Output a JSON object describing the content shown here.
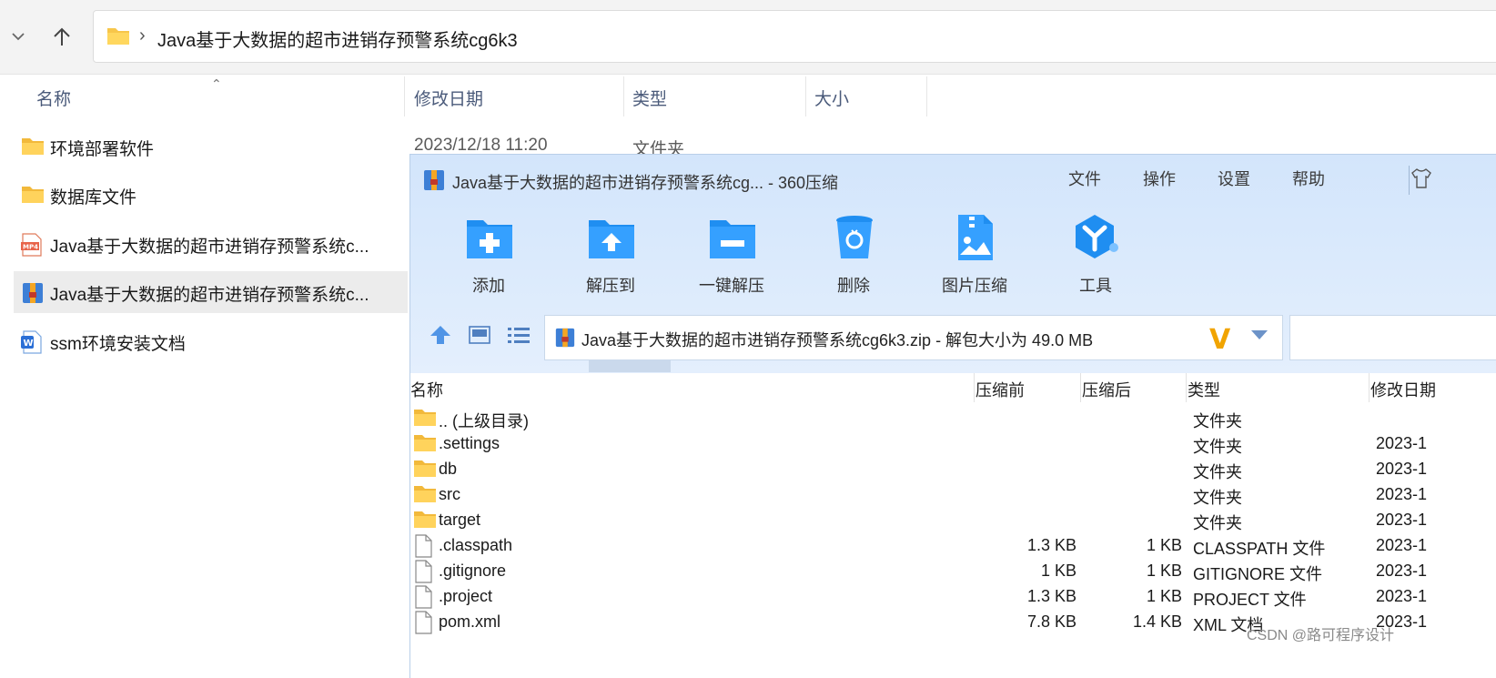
{
  "explorer": {
    "address_path": "Java基于大数据的超市进销存预警系统cg6k3",
    "columns": {
      "name": "名称",
      "modified": "修改日期",
      "type": "类型",
      "size": "大小"
    },
    "rows": [
      {
        "name": "环境部署软件",
        "icon": "folder-icon",
        "modified": "2023/12/18 11:20",
        "type": "文件夹"
      },
      {
        "name": "数据库文件",
        "icon": "folder-icon"
      },
      {
        "name": "Java基于大数据的超市进销存预警系统c...",
        "icon": "mp4-file-icon"
      },
      {
        "name": "Java基于大数据的超市进销存预警系统c...",
        "icon": "zip-archive-icon",
        "selected": true
      },
      {
        "name": "ssm环境安装文档",
        "icon": "word-doc-icon"
      }
    ]
  },
  "zip_window": {
    "title": "Java基于大数据的超市进销存预警系统cg... - 360压缩",
    "menu": [
      "文件",
      "操作",
      "设置",
      "帮助"
    ],
    "toolbar": [
      {
        "label": "添加",
        "icon": "add-icon"
      },
      {
        "label": "解压到",
        "icon": "extract-to-icon"
      },
      {
        "label": "一键解压",
        "icon": "one-click-extract-icon"
      },
      {
        "label": "删除",
        "icon": "delete-icon"
      },
      {
        "label": "图片压缩",
        "icon": "image-compress-icon"
      },
      {
        "label": "工具",
        "icon": "tools-icon"
      }
    ],
    "path_text": "Java基于大数据的超市进销存预警系统cg6k3.zip - 解包大小为 49.0 MB",
    "columns": {
      "name": "名称",
      "before": "压缩前",
      "after": "压缩后",
      "type": "类型",
      "modified": "修改日期"
    },
    "rows": [
      {
        "name": ".. (上级目录)",
        "icon": "folder-icon",
        "before": "",
        "after": "",
        "type": "文件夹",
        "date": ""
      },
      {
        "name": ".settings",
        "icon": "folder-icon",
        "before": "",
        "after": "",
        "type": "文件夹",
        "date": "2023-1"
      },
      {
        "name": "db",
        "icon": "folder-icon",
        "before": "",
        "after": "",
        "type": "文件夹",
        "date": "2023-1"
      },
      {
        "name": "src",
        "icon": "folder-icon",
        "before": "",
        "after": "",
        "type": "文件夹",
        "date": "2023-1"
      },
      {
        "name": "target",
        "icon": "folder-icon",
        "before": "",
        "after": "",
        "type": "文件夹",
        "date": "2023-1"
      },
      {
        "name": ".classpath",
        "icon": "file-icon",
        "before": "1.3 KB",
        "after": "1 KB",
        "type": "CLASSPATH 文件",
        "date": "2023-1"
      },
      {
        "name": ".gitignore",
        "icon": "file-icon",
        "before": "1 KB",
        "after": "1 KB",
        "type": "GITIGNORE 文件",
        "date": "2023-1"
      },
      {
        "name": ".project",
        "icon": "file-icon",
        "before": "1.3 KB",
        "after": "1 KB",
        "type": "PROJECT 文件",
        "date": "2023-1"
      },
      {
        "name": "pom.xml",
        "icon": "file-icon",
        "before": "7.8 KB",
        "after": "1.4 KB",
        "type": "XML 文档",
        "date": "2023-1"
      }
    ]
  },
  "watermark": "CSDN @路可程序设计"
}
